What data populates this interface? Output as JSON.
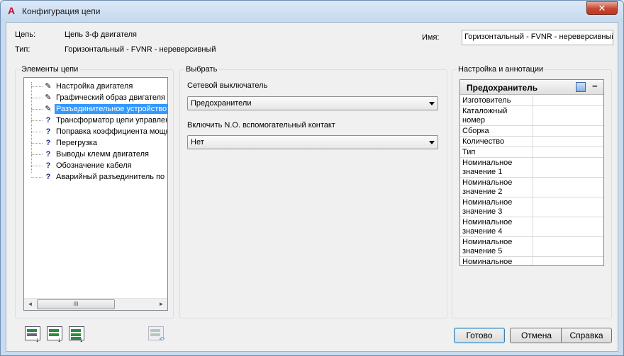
{
  "window": {
    "title": "Конфигурация цепи",
    "app_icon": "A",
    "close_glyph": "✕"
  },
  "info": {
    "circuit_label": "Цепь:",
    "circuit_value": "Цепь 3-ф двигателя",
    "type_label": "Тип:",
    "type_value": "Горизонтальный - FVNR - нереверсивный",
    "name_label": "Имя:",
    "name_value": "Горизонтальный - FVNR - нереверсивный"
  },
  "elements": {
    "title": "Элементы цепи",
    "items": [
      {
        "label": "Настройка двигателя",
        "icon": "pencil-icon",
        "glyph": "✎",
        "selected": false
      },
      {
        "label": "Графический образ двигателя",
        "icon": "pencil-icon",
        "glyph": "✎",
        "selected": false
      },
      {
        "label": "Разъединительное устройство",
        "icon": "pencil-icon",
        "glyph": "✎",
        "selected": true
      },
      {
        "label": "Трансформатор цепи управлен",
        "icon": "question-icon",
        "glyph": "?",
        "selected": false
      },
      {
        "label": "Поправка коэффициента мощн",
        "icon": "question-icon",
        "glyph": "?",
        "selected": false
      },
      {
        "label": "Перегрузка",
        "icon": "question-icon",
        "glyph": "?",
        "selected": false
      },
      {
        "label": "Выводы клемм двигателя",
        "icon": "question-icon",
        "glyph": "?",
        "selected": false
      },
      {
        "label": "Обозначение кабеля",
        "icon": "question-icon",
        "glyph": "?",
        "selected": false
      },
      {
        "label": "Аварийный разъединитель по",
        "icon": "question-icon",
        "glyph": "?",
        "selected": false
      }
    ],
    "scroll_left": "◄",
    "scroll_right": "►",
    "scroll_grip": "III"
  },
  "select": {
    "title": "Выбрать",
    "switch_label": "Сетевой выключатель",
    "switch_value": "Предохранители",
    "contact_label": "Включить N.O. вспомогательный контакт",
    "contact_value": "Нет"
  },
  "annotations": {
    "title": "Настройка и аннотации",
    "grid_title": "Предохранитель",
    "collapse_glyph": "−",
    "rows": [
      "Изготовитель",
      "Каталожный номер",
      "Сборка",
      "Количество",
      "Тип",
      "Номинальное значение 1",
      "Номинальное значение 2",
      "Номинальное значение 3",
      "Номинальное значение 4",
      "Номинальное значение 5",
      "Номинальное"
    ]
  },
  "buttons": {
    "ok": "Готово",
    "cancel": "Отмена",
    "help": "Справка"
  },
  "colors": {
    "selection": "#3399ff",
    "close_button": "#c7462f",
    "accent": "#c8102e"
  }
}
